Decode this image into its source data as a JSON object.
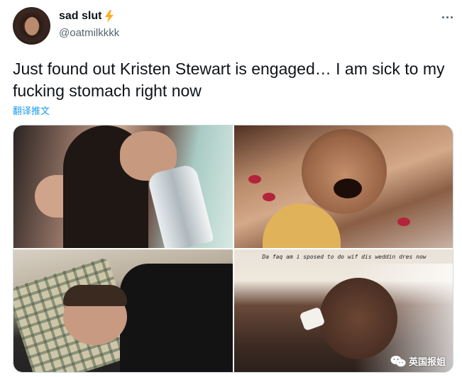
{
  "author": {
    "display_name": "sad slut",
    "handle": "@oatmilkkkk",
    "badge_icon": "lightning-bolt-icon"
  },
  "tweet": {
    "text": "Just found out Kristen Stewart is engaged… I am sick to my fucking stomach right now",
    "translate_label": "翻译推文"
  },
  "media": {
    "image_count": 4,
    "meme_caption": "Da faq am i sposed to do wif dis weddin dres now"
  },
  "watermark": {
    "icon": "wechat-icon",
    "label": "英国报姐"
  },
  "colors": {
    "text_primary": "#0f1419",
    "text_secondary": "#536471",
    "link": "#1d9bf0",
    "bolt": "#ffad1f"
  }
}
